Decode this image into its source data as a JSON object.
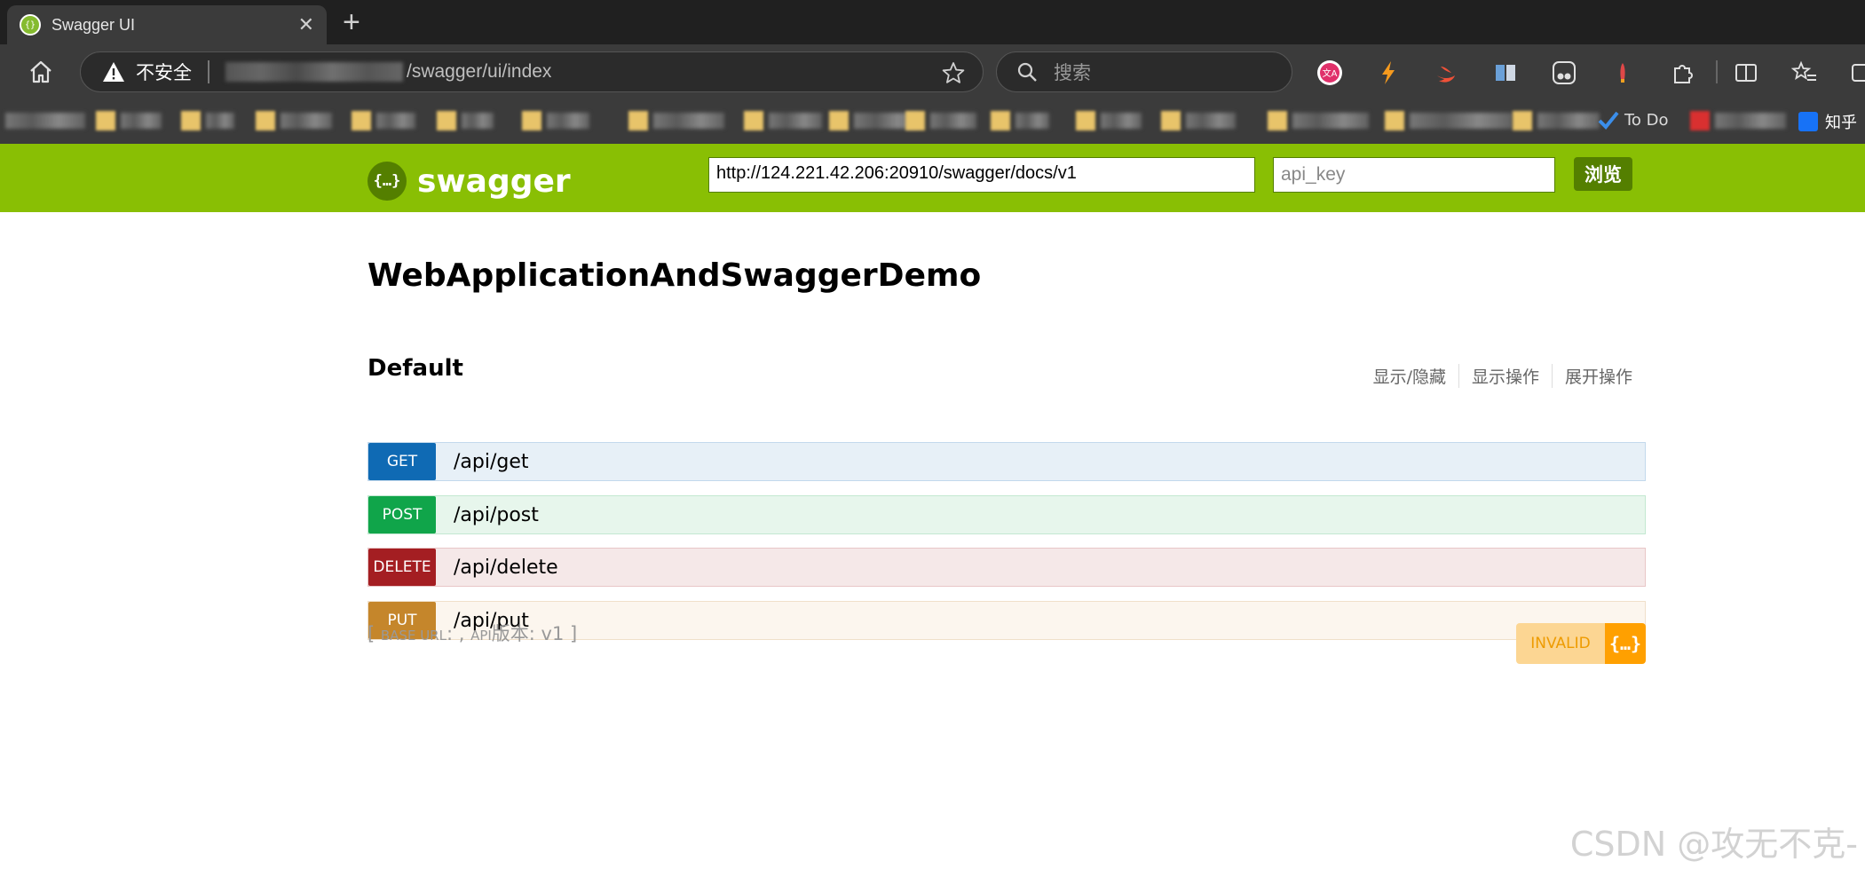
{
  "browser": {
    "tab_title": "Swagger UI",
    "tab_close": "✕",
    "new_tab": "+",
    "security_label": "不安全",
    "url_path": "/swagger/ui/index",
    "search_placeholder": "搜索",
    "bookmarks": [
      "To Do",
      "知乎"
    ]
  },
  "swagger": {
    "logo_icon": "{…}",
    "logo_text": "swagger",
    "spec_url": "http://124.221.42.206:20910/swagger/docs/v1",
    "api_key_placeholder": "api_key",
    "explore_label": "浏览",
    "title": "WebApplicationAndSwaggerDemo",
    "resource": {
      "name": "Default",
      "ops_links": [
        "显示/隐藏",
        "显示操作",
        "展开操作"
      ]
    },
    "operations": [
      {
        "method": "GET",
        "path": "/api/get",
        "color": "#0f6ab4",
        "bg": "#e7f0f7",
        "border": "#c3d9ec"
      },
      {
        "method": "POST",
        "path": "/api/post",
        "color": "#10a54a",
        "bg": "#e7f6ec",
        "border": "#c3e8d1"
      },
      {
        "method": "DELETE",
        "path": "/api/delete",
        "color": "#a41e22",
        "bg": "#f5e8e8",
        "border": "#e8c6c7"
      },
      {
        "method": "PUT",
        "path": "/api/put",
        "color": "#c5862b",
        "bg": "#fcf6ee",
        "border": "#f0e0ca"
      }
    ],
    "base_url_open": "[ ",
    "base_url_label": "BASE URL",
    "base_url_mid": ": , ",
    "api_label": "API",
    "version_text": "版本: v1 ]",
    "validator_label": "INVALID",
    "validator_icon": "{…}"
  },
  "watermark": "CSDN @攻无不克-"
}
